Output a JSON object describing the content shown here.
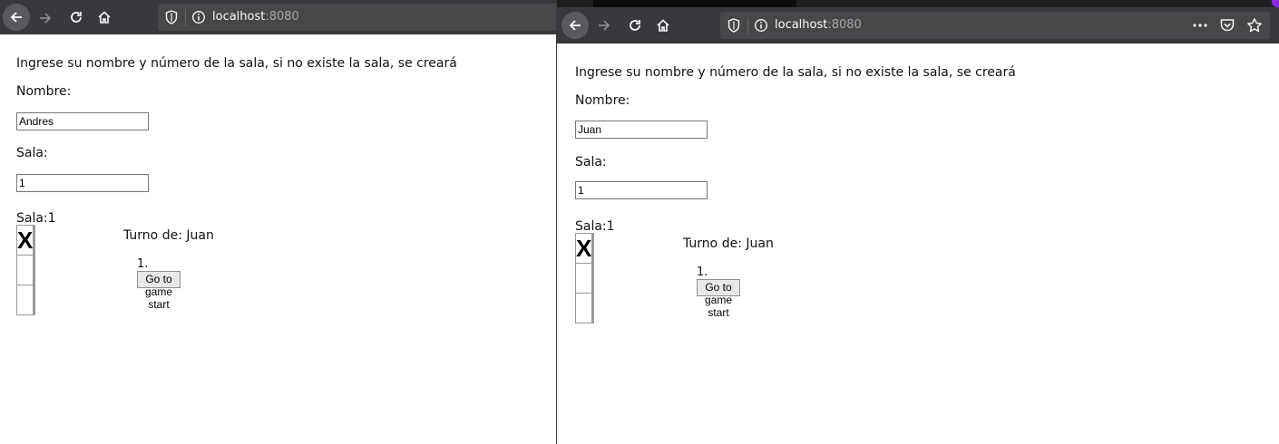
{
  "left": {
    "url": {
      "host": "localhost",
      "port": ":8080"
    },
    "intro": "Ingrese su nombre y número de la sala, si no existe la sala, se creará",
    "name_label": "Nombre:",
    "name_value": "Andres",
    "room_label": "Sala:",
    "room_value": "1",
    "room_title": "Sala:1",
    "board": [
      "X",
      "",
      "",
      "",
      "",
      "",
      "",
      "",
      ""
    ],
    "turn": "Turno de: Juan",
    "moves": [
      {
        "num": "1.",
        "label": "Go to game start"
      }
    ]
  },
  "right": {
    "url": {
      "host": "localhost",
      "port": ":8080"
    },
    "intro": "Ingrese su nombre y número de la sala, si no existe la sala, se creará",
    "name_label": "Nombre:",
    "name_value": "Juan",
    "room_label": "Sala:",
    "room_value": "1",
    "room_title": "Sala:1",
    "board": [
      "X",
      "",
      "",
      "",
      "",
      "",
      "",
      "",
      ""
    ],
    "turn": "Turno de: Juan",
    "moves": [
      {
        "num": "1.",
        "label": "Go to game start"
      }
    ]
  },
  "icons": [
    "back-arrow-icon",
    "forward-arrow-icon",
    "reload-icon",
    "home-icon",
    "shield-icon",
    "info-icon",
    "more-dots-icon",
    "pocket-icon",
    "bookmark-star-icon"
  ],
  "colors": {
    "toolbar": "#38383d",
    "urlbar": "#474749",
    "accent": "#8a2be2"
  }
}
